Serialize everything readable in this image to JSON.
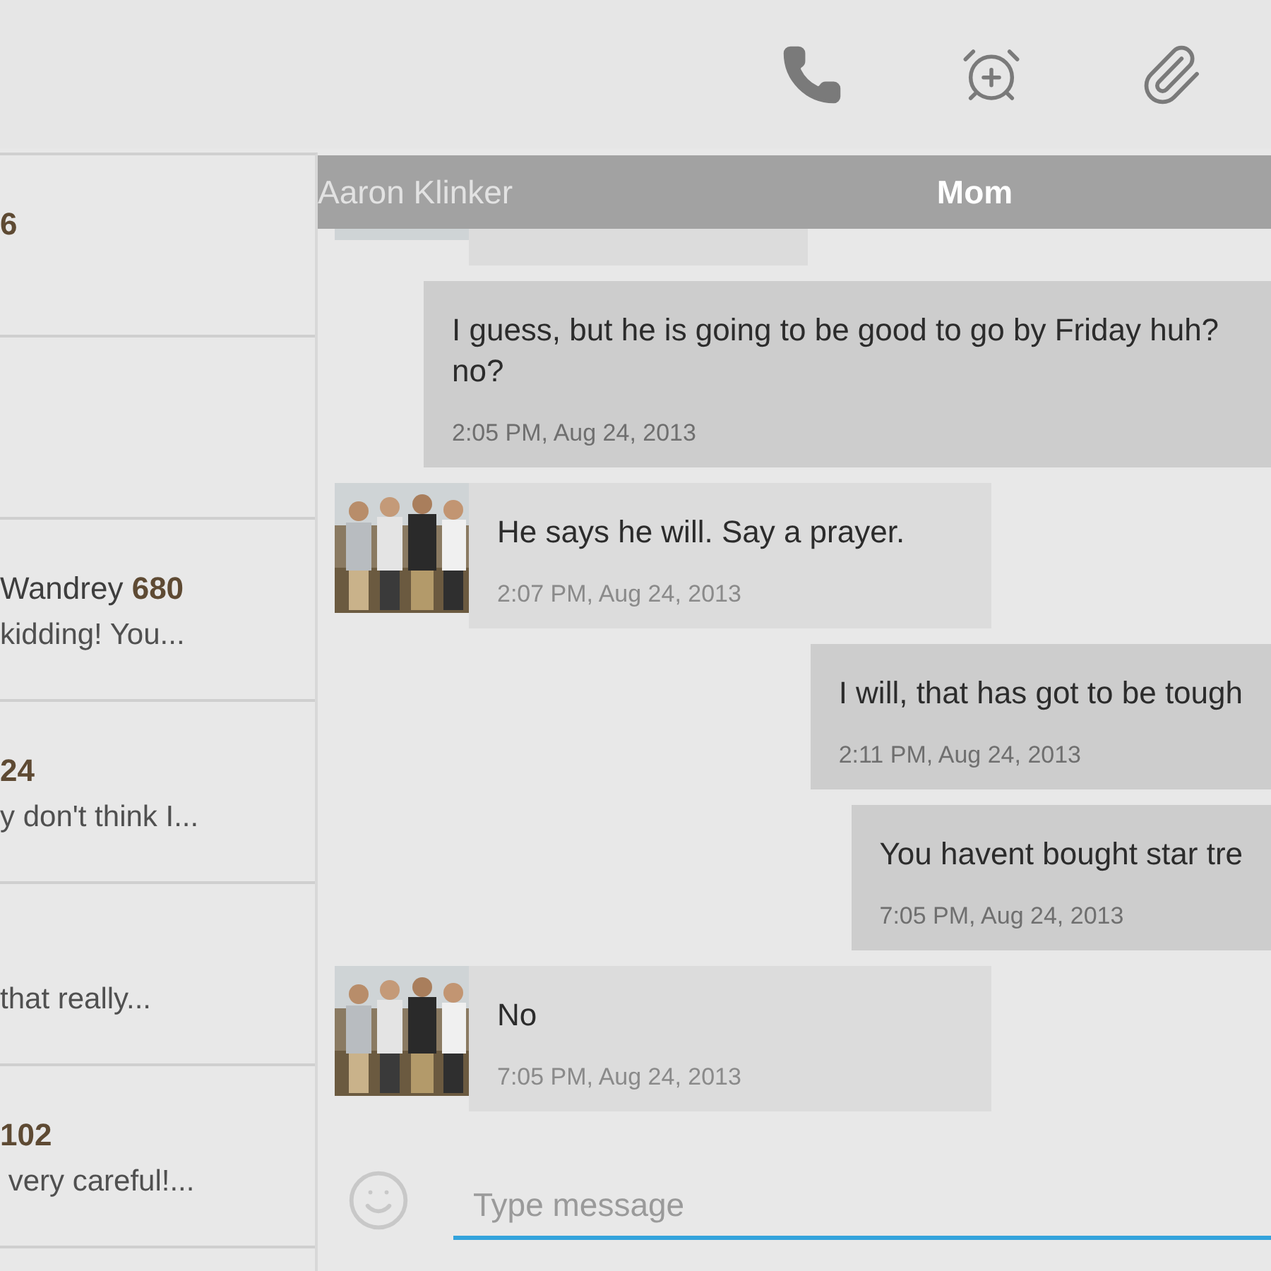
{
  "toolbar": {
    "actions": [
      {
        "kind": "phone"
      },
      {
        "kind": "alarm"
      },
      {
        "kind": "attach"
      }
    ]
  },
  "conversations": [
    {
      "kind": "thread",
      "count": "6"
    },
    {
      "kind": "thread"
    },
    {
      "kind": "thread",
      "name": "Wandrey",
      "count": "680",
      "preview": "kidding! You..."
    },
    {
      "kind": "thread",
      "count": "24",
      "preview": "y don't think I..."
    },
    {
      "kind": "thread",
      "preview": "that really..."
    },
    {
      "kind": "thread",
      "count": "102",
      "preview": " very careful!..."
    }
  ],
  "tabs": [
    {
      "label": "Aaron Klinker",
      "selected": false
    },
    {
      "label": "Mom",
      "selected": true
    }
  ],
  "messages": [
    {
      "kind": "received"
    },
    {
      "kind": "sent",
      "text": "I guess, but he is going to be good to go by Friday huh? no?",
      "time": "2:05 PM, Aug 24, 2013"
    },
    {
      "kind": "received",
      "text": "He says he will.  Say a prayer.",
      "time": "2:07 PM, Aug 24, 2013"
    },
    {
      "kind": "sent",
      "text": "I will, that has got to be tough",
      "time": "2:11 PM, Aug 24, 2013"
    },
    {
      "kind": "sent",
      "text": "You havent bought star tre",
      "time": "7:05 PM, Aug 24, 2013"
    },
    {
      "kind": "received",
      "text": "No",
      "time": "7:05 PM, Aug 24, 2013"
    }
  ],
  "composer": {
    "placeholder": "Type message"
  }
}
